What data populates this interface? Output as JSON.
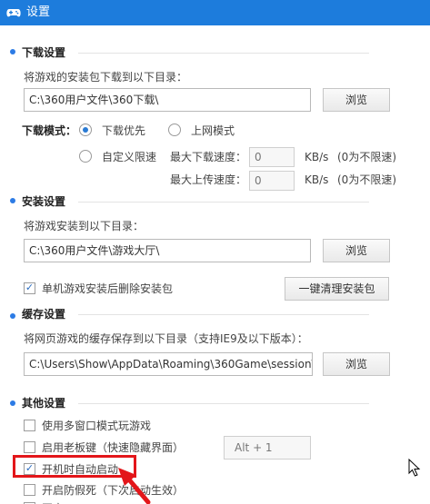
{
  "window": {
    "title": "设置",
    "icon": "gamepad-icon"
  },
  "download": {
    "section_title": "下载设置",
    "dir_label": "将游戏的安装包下载到以下目录：",
    "dir_value": "C:\\360用户文件\\360下载\\",
    "browse_label": "浏览",
    "mode_label": "下载模式：",
    "mode_options": [
      "下载优先",
      "上网模式",
      "自定义限速"
    ],
    "mode_selected": "下载优先",
    "max_down_label": "最大下载速度：",
    "max_down_value": "0",
    "max_up_label": "最大上传速度：",
    "max_up_value": "0",
    "unit": "KB/s",
    "unlimited_hint": "(0为不限速)"
  },
  "install": {
    "section_title": "安装设置",
    "dir_label": "将游戏安装到以下目录：",
    "dir_value": "C:\\360用户文件\\游戏大厅\\",
    "browse_label": "浏览",
    "delete_pkg_label": "单机游戏安装后删除安装包",
    "delete_pkg_checked": true,
    "clean_button_label": "一键清理安装包"
  },
  "cache": {
    "section_title": "缓存设置",
    "dir_label": "将网页游戏的缓存保存到以下目录（支持IE9及以下版本）：",
    "dir_value": "C:\\Users\\Show\\AppData\\Roaming\\360Game\\session\\",
    "browse_label": "浏览"
  },
  "other": {
    "section_title": "其他设置",
    "multi_window_label": "使用多窗口模式玩游戏",
    "multi_window_checked": false,
    "boss_key_label": "启用老板键（快速隐藏界面）",
    "boss_key_checked": false,
    "boss_key_value": "Alt + 1",
    "autostart_label": "开机时自动启动",
    "autostart_checked": true,
    "anti_freeze_label": "开启防假死（下次启动生效）",
    "anti_freeze_checked": false,
    "partial_label": "开启",
    "partial_checked": false
  },
  "colors": {
    "titlebar": "#1d7cdc",
    "accent": "#2c7be5",
    "highlight": "#e3161a"
  }
}
